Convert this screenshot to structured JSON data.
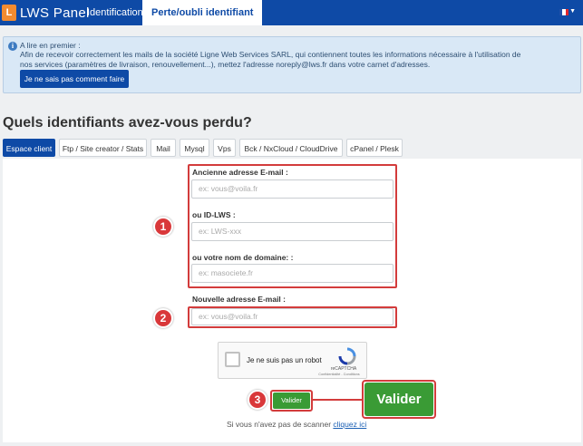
{
  "header": {
    "logo_mark": "L",
    "logo_text": "LWS Panel",
    "nav": [
      "Identification",
      "Perte/oubli identifiant"
    ],
    "flag_colors": [
      "#1f4fa8",
      "#ffffff",
      "#e0262e"
    ]
  },
  "notice": {
    "title": "A lire en premier :",
    "body": "Afin de recevoir correctement les mails de la société Ligne Web Services SARL, qui contiennent toutes les informations nécessaire à l'utilisation de nos services (paramètres de livraison, renouvellement...), mettez l'adresse noreply@lws.fr dans votre carnet d'adresses.",
    "button": "Je ne sais pas comment faire"
  },
  "page_title": "Quels identifiants avez-vous perdu?",
  "tabs": [
    "Espace client",
    "Ftp / Site creator / Stats",
    "Mail",
    "Mysql",
    "Vps",
    "Bck / NxCloud / CloudDrive",
    "cPanel / Plesk"
  ],
  "form": {
    "email_label": "Ancienne adresse E-mail :",
    "email_placeholder": "ex: vous@voila.fr",
    "id_label": "ou ID-LWS :",
    "id_placeholder": "ex: LWS-xxx",
    "domain_label": "ou votre nom de domaine: :",
    "domain_placeholder": "ex: masociete.fr",
    "new_email_label": "Nouvelle adresse E-mail :",
    "new_email_placeholder": "ex: vous@voila.fr"
  },
  "captcha": {
    "label": "Je ne suis pas un robot",
    "brand": "reCAPTCHA",
    "terms": "Confidentialité - Conditions"
  },
  "submit": "Valider",
  "submit_zoom": "Valider",
  "scan": {
    "text": "Si vous n'avez pas de scanner",
    "link": "cliquez ici"
  },
  "annotations": [
    "1",
    "2",
    "3"
  ]
}
